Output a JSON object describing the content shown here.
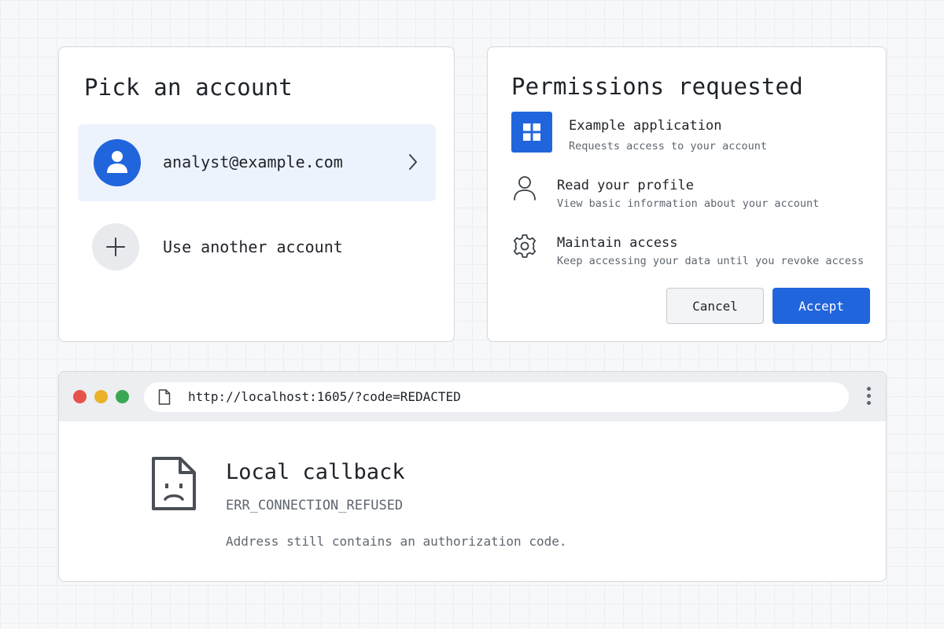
{
  "colors": {
    "accent": "#2165dd",
    "selected_row": "#edf3fd",
    "window_red": "#e5534b",
    "window_yellow": "#e9b22a",
    "window_green": "#3aa852"
  },
  "account_picker": {
    "title": "Pick an account",
    "accounts": [
      {
        "email": "analyst@example.com",
        "icon": "person-avatar-icon"
      }
    ],
    "add_account_label": "Use another account"
  },
  "permissions": {
    "title": "Permissions requested",
    "app": {
      "name": "Example application",
      "subtitle": "Requests access to your account",
      "icon": "app-grid-icon"
    },
    "items": [
      {
        "name": "Read your profile",
        "description": "View basic information about your account",
        "icon": "person-outline-icon"
      },
      {
        "name": "Maintain access",
        "description": "Keep accessing your data until you revoke access",
        "icon": "gear-icon"
      }
    ],
    "cancel_label": "Cancel",
    "accept_label": "Accept"
  },
  "browser": {
    "url": "http://localhost:1605/?code=REDACTED",
    "error_title": "Local callback",
    "error_code": "ERR_CONNECTION_REFUSED",
    "error_note": "Address still contains an authorization code."
  }
}
